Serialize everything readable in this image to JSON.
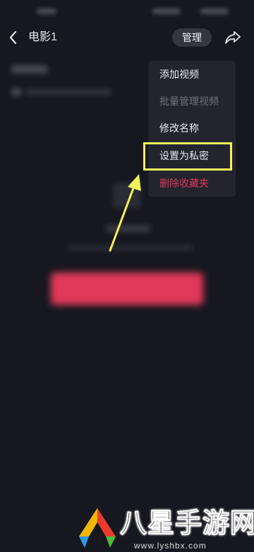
{
  "header": {
    "title": "电影1",
    "manage_label": "管理"
  },
  "menu": {
    "items": [
      {
        "label": "添加视频",
        "state": "normal"
      },
      {
        "label": "批量管理视频",
        "state": "disabled"
      },
      {
        "label": "修改名称",
        "state": "normal"
      },
      {
        "label": "设置为私密",
        "state": "highlighted"
      },
      {
        "label": "删除收藏夹",
        "state": "danger"
      }
    ]
  },
  "annotation": {
    "highlight_color": "#f1f25c",
    "arrow_color": "#f1f25c"
  },
  "colors": {
    "background": "#16171f",
    "menu_background": "#23242e",
    "danger": "#e1365a",
    "disabled": "#6f707a"
  },
  "watermark": {
    "title": "八星手游网",
    "url": "www.lyshbx.com"
  },
  "icons": [
    "chevron-left-icon",
    "share-icon",
    "watermark-logo-icon"
  ]
}
